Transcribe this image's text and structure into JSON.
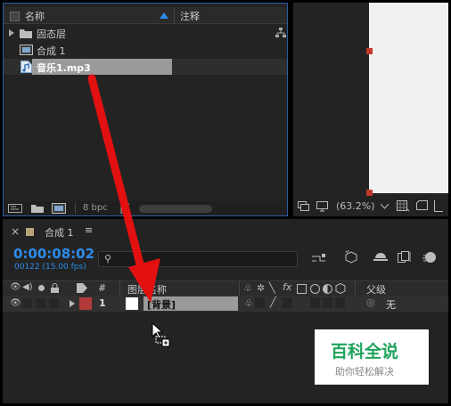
{
  "project_panel": {
    "columns": {
      "name": "名称",
      "comment": "注释"
    },
    "items": [
      {
        "label": "固态层",
        "type": "folder"
      },
      {
        "label": "合成 1",
        "type": "composition"
      },
      {
        "label": "音乐1.mp3",
        "type": "audio",
        "selected": true
      }
    ],
    "footer": {
      "bpc": "8 bpc"
    }
  },
  "viewer": {
    "zoom": "(63.2%)"
  },
  "timeline": {
    "tab_label": "合成 1",
    "menu_glyph": "≡",
    "timecode": "0:00:08:02",
    "frame_info": "00122 (15.00 fps)",
    "search_placeholder": "",
    "columns": {
      "number": "#",
      "source_name": "图层名称",
      "fx": "fx",
      "parent": "父级"
    },
    "layer": {
      "number": "1",
      "name": "[背景]",
      "parent": "无",
      "label_color": "#b23a3a"
    }
  },
  "watermark": {
    "title": "百科全说",
    "subtitle": "助你轻松解决"
  },
  "colors": {
    "panel": "#232323",
    "selection": "#9a9a9a",
    "accent_blue": "#2d8ceb",
    "panel_border": "#2d5da8",
    "arrow": "#e21010",
    "watermark_green": "#1fa35a"
  }
}
